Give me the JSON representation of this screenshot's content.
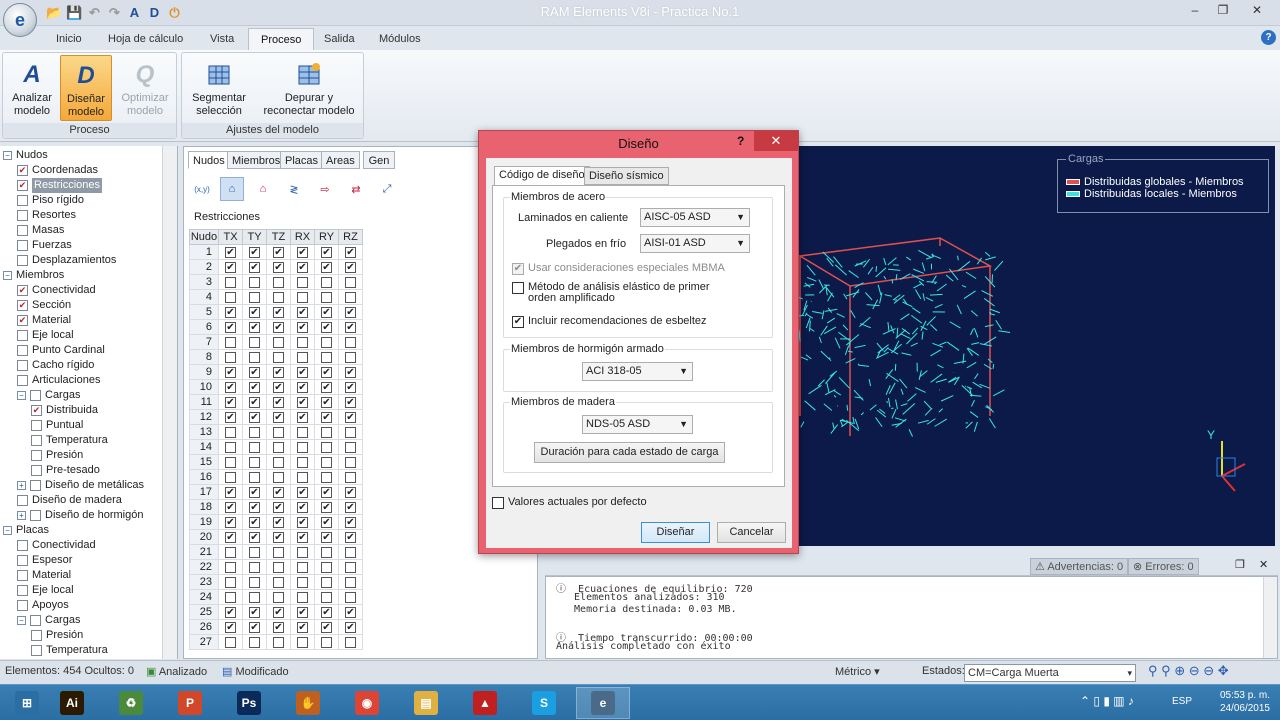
{
  "window": {
    "title": "RAM Elements V8i - Practica No.1",
    "app_icon": "e",
    "controls": [
      "–",
      "❐",
      "✕"
    ]
  },
  "quick_access": [
    "📂",
    "💾",
    "↶",
    "↷",
    "A",
    "D",
    "⏻"
  ],
  "ribbon": {
    "tabs": [
      "Inicio",
      "Hoja de cálculo",
      "Vista",
      "Proceso",
      "Salida",
      "Módulos"
    ],
    "active_tab": "Proceso",
    "help": "?",
    "groups": [
      {
        "label": "Proceso",
        "buttons": [
          {
            "line1": "Analizar",
            "line2": "modelo",
            "icon": "A"
          },
          {
            "line1": "Diseñar",
            "line2": "modelo",
            "icon": "D"
          },
          {
            "line1": "Optimizar",
            "line2": "modelo",
            "icon": "Q"
          }
        ]
      },
      {
        "label": "Ajustes del modelo",
        "buttons": [
          {
            "line1": "Segmentar",
            "line2": "selección"
          },
          {
            "line1": "Depurar y",
            "line2": "reconectar modelo"
          }
        ]
      }
    ]
  },
  "tree": [
    {
      "label": "Nudos",
      "lvl": 0,
      "exp": "−"
    },
    {
      "label": "Coordenadas",
      "lvl": 1,
      "chk": true
    },
    {
      "label": "Restricciones",
      "lvl": 1,
      "chk": true,
      "sel": true
    },
    {
      "label": "Piso rígido",
      "lvl": 1
    },
    {
      "label": "Resortes",
      "lvl": 1
    },
    {
      "label": "Masas",
      "lvl": 1
    },
    {
      "label": "Fuerzas",
      "lvl": 1
    },
    {
      "label": "Desplazamientos",
      "lvl": 1
    },
    {
      "label": "Miembros",
      "lvl": 0,
      "exp": "−"
    },
    {
      "label": "Conectividad",
      "lvl": 1,
      "chk": true
    },
    {
      "label": "Sección",
      "lvl": 1,
      "chk": true
    },
    {
      "label": "Material",
      "lvl": 1,
      "chk": true
    },
    {
      "label": "Eje local",
      "lvl": 1
    },
    {
      "label": "Punto Cardinal",
      "lvl": 1
    },
    {
      "label": "Cacho rígido",
      "lvl": 1
    },
    {
      "label": "Articulaciones",
      "lvl": 1
    },
    {
      "label": "Cargas",
      "lvl": 1,
      "exp": "−"
    },
    {
      "label": "Distribuida",
      "lvl": 2,
      "chk": true
    },
    {
      "label": "Puntual",
      "lvl": 2
    },
    {
      "label": "Temperatura",
      "lvl": 2
    },
    {
      "label": "Presión",
      "lvl": 2
    },
    {
      "label": "Pre-tesado",
      "lvl": 2
    },
    {
      "label": "Diseño de metálicas",
      "lvl": 1,
      "exp": "+"
    },
    {
      "label": "Diseño de madera",
      "lvl": 1
    },
    {
      "label": "Diseño de hormigón",
      "lvl": 1,
      "exp": "+"
    },
    {
      "label": "Placas",
      "lvl": 0,
      "exp": "−"
    },
    {
      "label": "Conectividad",
      "lvl": 1
    },
    {
      "label": "Espesor",
      "lvl": 1
    },
    {
      "label": "Material",
      "lvl": 1
    },
    {
      "label": "Eje local",
      "lvl": 1
    },
    {
      "label": "Apoyos",
      "lvl": 1
    },
    {
      "label": "Cargas",
      "lvl": 1,
      "exp": "−"
    },
    {
      "label": "Presión",
      "lvl": 2
    },
    {
      "label": "Temperatura",
      "lvl": 2
    }
  ],
  "mid_panel": {
    "tabs": [
      "Nudos",
      "Miembros",
      "Placas",
      "Areas",
      "Gen"
    ],
    "active_tab": "Nudos",
    "tools": [
      "(x,y)",
      "⌂",
      "⌂",
      "≷",
      "⇨",
      "⇄",
      "⤢"
    ],
    "title": "Restricciones",
    "columns": [
      "Nudo",
      "TX",
      "TY",
      "TZ",
      "RX",
      "RY",
      "RZ"
    ],
    "rows": [
      {
        "n": "1",
        "c": [
          1,
          1,
          1,
          1,
          1,
          1
        ]
      },
      {
        "n": "2",
        "c": [
          1,
          1,
          1,
          1,
          1,
          1
        ]
      },
      {
        "n": "3",
        "c": [
          0,
          0,
          0,
          0,
          0,
          0
        ]
      },
      {
        "n": "4",
        "c": [
          0,
          0,
          0,
          0,
          0,
          0
        ]
      },
      {
        "n": "5",
        "c": [
          1,
          1,
          1,
          1,
          1,
          1
        ]
      },
      {
        "n": "6",
        "c": [
          1,
          1,
          1,
          1,
          1,
          1
        ]
      },
      {
        "n": "7",
        "c": [
          0,
          0,
          0,
          0,
          0,
          0
        ]
      },
      {
        "n": "8",
        "c": [
          0,
          0,
          0,
          0,
          0,
          0
        ]
      },
      {
        "n": "9",
        "c": [
          1,
          1,
          1,
          1,
          1,
          1
        ]
      },
      {
        "n": "10",
        "c": [
          1,
          1,
          1,
          1,
          1,
          1
        ]
      },
      {
        "n": "11",
        "c": [
          1,
          1,
          1,
          1,
          1,
          1
        ]
      },
      {
        "n": "12",
        "c": [
          1,
          1,
          1,
          1,
          1,
          1
        ]
      },
      {
        "n": "13",
        "c": [
          0,
          0,
          0,
          0,
          0,
          0
        ]
      },
      {
        "n": "14",
        "c": [
          0,
          0,
          0,
          0,
          0,
          0
        ]
      },
      {
        "n": "15",
        "c": [
          0,
          0,
          0,
          0,
          0,
          0
        ]
      },
      {
        "n": "16",
        "c": [
          0,
          0,
          0,
          0,
          0,
          0
        ]
      },
      {
        "n": "17",
        "c": [
          1,
          1,
          1,
          1,
          1,
          1
        ]
      },
      {
        "n": "18",
        "c": [
          1,
          1,
          1,
          1,
          1,
          1
        ]
      },
      {
        "n": "19",
        "c": [
          1,
          1,
          1,
          1,
          1,
          1
        ]
      },
      {
        "n": "20",
        "c": [
          1,
          1,
          1,
          1,
          1,
          1
        ]
      },
      {
        "n": "21",
        "c": [
          0,
          0,
          0,
          0,
          0,
          0
        ]
      },
      {
        "n": "22",
        "c": [
          0,
          0,
          0,
          0,
          0,
          0
        ]
      },
      {
        "n": "23",
        "c": [
          0,
          0,
          0,
          0,
          0,
          0
        ]
      },
      {
        "n": "24",
        "c": [
          0,
          0,
          0,
          0,
          0,
          0
        ]
      },
      {
        "n": "25",
        "c": [
          1,
          1,
          1,
          1,
          1,
          1
        ]
      },
      {
        "n": "26",
        "c": [
          1,
          1,
          1,
          1,
          1,
          1
        ]
      },
      {
        "n": "27",
        "c": [
          0,
          0,
          0,
          0,
          0,
          0
        ]
      }
    ]
  },
  "view3d": {
    "legend_title": "Cargas",
    "legend": [
      {
        "label": "Distribuidas globales - Miembros",
        "color": "#e05050"
      },
      {
        "label": "Distribuidas locales - Miembros",
        "color": "#40e0e0"
      }
    ],
    "bg": "#0c1a4a",
    "axis_y": "Y"
  },
  "log": {
    "warnings": "Advertencias: 0",
    "errors": "Errores: 0",
    "lines": [
      "Ecuaciones de equilibrio: 720",
      "  Elementos analizados: 310",
      "  Memoria destinada: 0.03 MB.",
      "",
      "Tiempo transcurrido: 00:00:00",
      "Análisis completado con éxito"
    ]
  },
  "status": {
    "elements": "Elementos: 454 Ocultos: 0",
    "analyzed": "Analizado",
    "modified": "Modificado",
    "units": "Métrico",
    "states_label": "Estados:",
    "state_value": "CM=Carga Muerta"
  },
  "taskbar": {
    "apps": [
      {
        "label": "⊞",
        "color": "#2a6ea4"
      },
      {
        "label": "Ai",
        "color": "#2b1a00"
      },
      {
        "label": "♻",
        "color": "#4a8a3a"
      },
      {
        "label": "P",
        "color": "#d0472a"
      },
      {
        "label": "Ps",
        "color": "#0a2a5a"
      },
      {
        "label": "✋",
        "color": "#c06020"
      },
      {
        "label": "◉",
        "color": "#dd4433"
      },
      {
        "label": "▤",
        "color": "#e0b040"
      },
      {
        "label": "▲",
        "color": "#c02020"
      },
      {
        "label": "S",
        "color": "#1aa0e0"
      },
      {
        "label": "e",
        "color": "#4a6a8a"
      }
    ],
    "lang": "ESP",
    "time": "05:53 p. m.",
    "date": "24/06/2015"
  },
  "dialog": {
    "title": "Diseño",
    "help": "?",
    "close": "✕",
    "tabs": [
      "Código de diseño",
      "Diseño sísmico"
    ],
    "steel_group": "Miembros de acero",
    "hot_label": "Laminados en caliente",
    "hot_value": "AISC-05 ASD",
    "cold_label": "Plegados en frío",
    "cold_value": "AISI-01 ASD",
    "opt_mbma": "Usar consideraciones especiales MBMA",
    "opt_elastic": "Método de análisis elástico de primer orden amplificado",
    "opt_slender": "Incluir recomendaciones de esbeltez",
    "concrete_group": "Miembros de hormigón armado",
    "concrete_value": "ACI 318-05",
    "wood_group": "Miembros de madera",
    "wood_value": "NDS-05 ASD",
    "duration_btn": "Duración para cada estado de carga",
    "defaults": "Valores actuales por defecto",
    "ok": "Diseñar",
    "cancel": "Cancelar"
  }
}
